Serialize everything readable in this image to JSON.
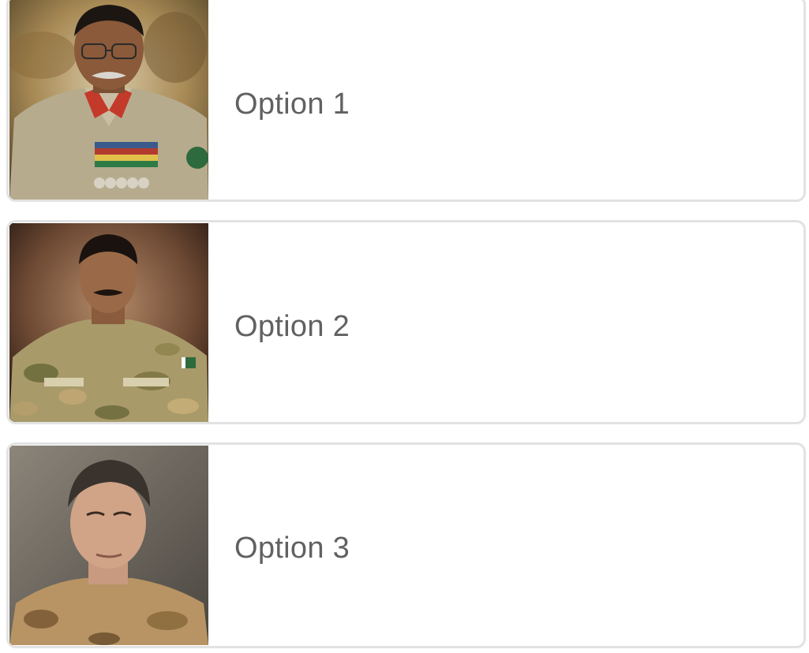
{
  "options": [
    {
      "label": "Option 1",
      "image": "portrait-officer-ceremonial-uniform"
    },
    {
      "label": "Option 2",
      "image": "portrait-officer-camouflage-uniform"
    },
    {
      "label": "Option 3",
      "image": "portrait-officer-camouflage-uniform"
    }
  ],
  "colors": {
    "card_border": "#e2e2e2",
    "label_text": "#616161",
    "background": "#ffffff"
  }
}
